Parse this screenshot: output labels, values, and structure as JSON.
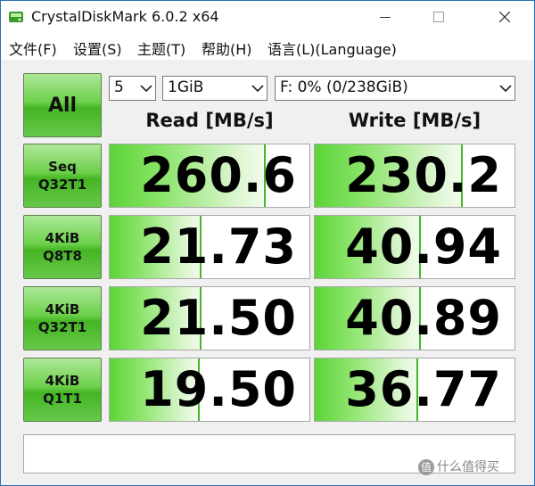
{
  "window": {
    "title": "CrystalDiskMark 6.0.2 x64",
    "icons": {
      "app": "crystaldiskmark-disk-icon",
      "minimize": "minimize-icon",
      "maximize": "maximize-icon",
      "close": "close-icon"
    }
  },
  "menu": {
    "items": [
      "文件(F)",
      "设置(S)",
      "主题(T)",
      "帮助(H)",
      "语言(L)(Language)"
    ]
  },
  "controls": {
    "all_label": "All",
    "test_count": "5",
    "test_size": "1GiB",
    "drive": "F: 0% (0/238GiB)"
  },
  "headers": {
    "read": "Read [MB/s]",
    "write": "Write [MB/s]"
  },
  "rows": [
    {
      "line1": "Seq",
      "line2": "Q32T1",
      "read": "260.6",
      "write": "230.2",
      "read_fill": 0.78,
      "write_fill": 0.74
    },
    {
      "line1": "4KiB",
      "line2": "Q8T8",
      "read": "21.73",
      "write": "40.94",
      "read_fill": 0.46,
      "write_fill": 0.53
    },
    {
      "line1": "4KiB",
      "line2": "Q32T1",
      "read": "21.50",
      "write": "40.89",
      "read_fill": 0.46,
      "write_fill": 0.53
    },
    {
      "line1": "4KiB",
      "line2": "Q1T1",
      "read": "19.50",
      "write": "36.77",
      "read_fill": 0.45,
      "write_fill": 0.52
    }
  ],
  "comment": "",
  "watermark": {
    "icon_char": "值",
    "text": "什么值得买"
  },
  "colors": {
    "accent_green": "#45b524",
    "bar_green": "#5bd437",
    "title_border": "#2b6fb6"
  }
}
